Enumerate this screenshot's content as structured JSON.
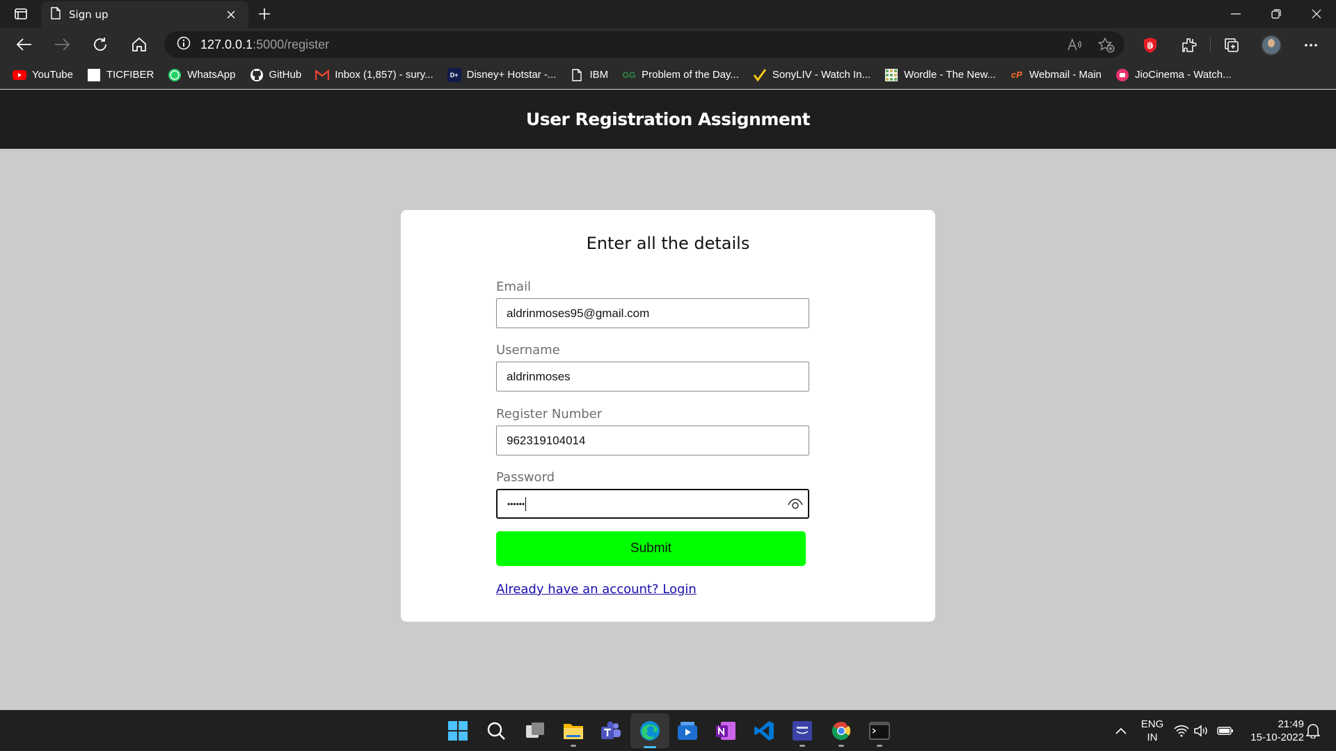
{
  "browser": {
    "tab_title": "Sign up",
    "url_host": "127.0.0.1",
    "url_path": ":5000/register",
    "bookmarks": [
      {
        "label": "YouTube",
        "icon": "youtube-icon",
        "color": "#ff0000"
      },
      {
        "label": "TICFIBER",
        "icon": "page-icon",
        "color": "#ffffff"
      },
      {
        "label": "WhatsApp",
        "icon": "whatsapp-icon",
        "color": "#25d366"
      },
      {
        "label": "GitHub",
        "icon": "github-icon",
        "color": "#ffffff"
      },
      {
        "label": "Inbox (1,857) - sury...",
        "icon": "gmail-icon",
        "color": "#ea4335"
      },
      {
        "label": "Disney+ Hotstar -...",
        "icon": "hotstar-icon",
        "color": "#0f1b4c"
      },
      {
        "label": "IBM",
        "icon": "page-icon",
        "color": "#ffffff"
      },
      {
        "label": "Problem of the Day...",
        "icon": "geeksforgeeks-icon",
        "color": "#2f8d46"
      },
      {
        "label": "SonyLIV - Watch In...",
        "icon": "sonyliv-icon",
        "color": "#f5c518"
      },
      {
        "label": "Wordle - The New...",
        "icon": "wordle-icon",
        "color": "#6aaa64"
      },
      {
        "label": "Webmail - Main",
        "icon": "cpanel-icon",
        "color": "#ff6c2c"
      },
      {
        "label": "JioCinema - Watch...",
        "icon": "jiocinema-icon",
        "color": "#e8336d"
      }
    ]
  },
  "page": {
    "header_title": "User Registration Assignment",
    "form_title": "Enter all the details",
    "fields": {
      "email": {
        "label": "Email",
        "value": "aldrinmoses95@gmail.com"
      },
      "username": {
        "label": "Username",
        "value": "aldrinmoses"
      },
      "register_number": {
        "label": "Register Number",
        "value": "962319104014"
      },
      "password": {
        "label": "Password",
        "value": "••••••"
      }
    },
    "submit_label": "Submit",
    "login_link": "Already have an account? Login",
    "accent_color": "#00ff00"
  },
  "taskbar": {
    "language": "ENG",
    "region": "IN",
    "time": "21:49",
    "date": "15-10-2022"
  }
}
